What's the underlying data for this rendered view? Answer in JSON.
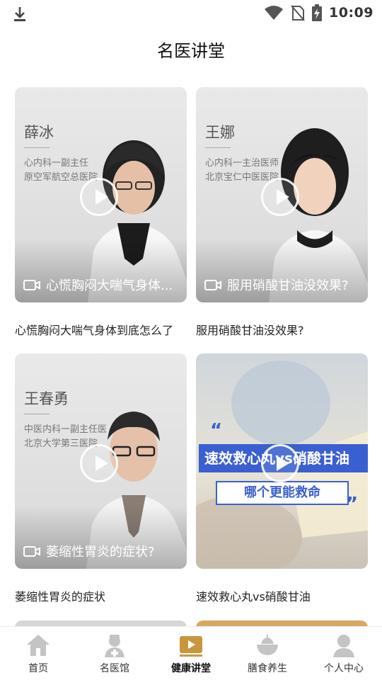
{
  "status_bar": {
    "time": "10:09"
  },
  "header": {
    "title": "名医讲堂"
  },
  "videos": [
    {
      "doctor_name": "薛冰",
      "doctor_info": [
        "心内科一副主任",
        "原空军航空总医院"
      ],
      "overlay_title": "心慌胸闷大喘气身体...",
      "caption": "心慌胸闷大喘气身体到底怎么了"
    },
    {
      "doctor_name": "王娜",
      "doctor_info": [
        "心内科一主治医师",
        "北京宝仁中医医院"
      ],
      "overlay_title": "服用硝酸甘油没效果?",
      "caption": "服用硝酸甘油没效果?"
    },
    {
      "doctor_name": "王春勇",
      "doctor_info": [
        "中医内科一副主任医",
        "北京大学第三医院"
      ],
      "overlay_title": "萎缩性胃炎的症状?",
      "caption": "萎缩性胃炎的症状"
    },
    {
      "promo_line1": "速效救心丸vs硝酸甘油",
      "promo_line2": "哪个更能救命",
      "caption": "速效救心丸vs硝酸甘油"
    }
  ],
  "tabbar": {
    "tabs": [
      {
        "label": "首页",
        "icon": "home-icon"
      },
      {
        "label": "名医馆",
        "icon": "doctor-icon"
      },
      {
        "label": "健康讲堂",
        "icon": "video-icon"
      },
      {
        "label": "膳食养生",
        "icon": "food-bowl-icon"
      },
      {
        "label": "个人中心",
        "icon": "user-icon"
      }
    ],
    "active": "健康讲堂",
    "active_color": "#c9963e",
    "inactive_color": "#c4c4c4"
  }
}
